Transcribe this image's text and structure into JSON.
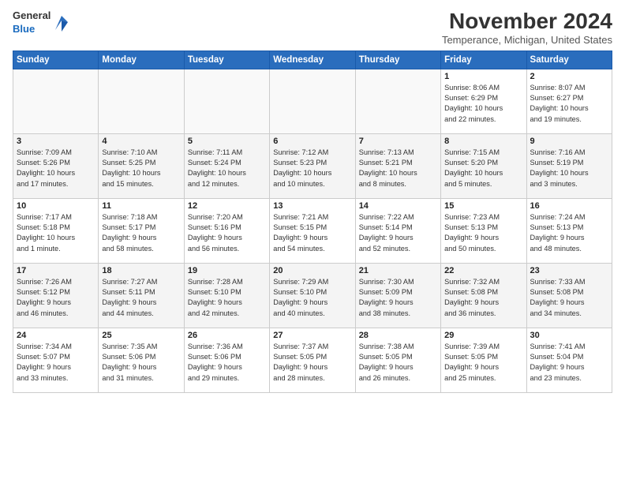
{
  "logo": {
    "line1": "General",
    "line2": "Blue"
  },
  "title": "November 2024",
  "location": "Temperance, Michigan, United States",
  "weekdays": [
    "Sunday",
    "Monday",
    "Tuesday",
    "Wednesday",
    "Thursday",
    "Friday",
    "Saturday"
  ],
  "weeks": [
    [
      {
        "day": "",
        "info": ""
      },
      {
        "day": "",
        "info": ""
      },
      {
        "day": "",
        "info": ""
      },
      {
        "day": "",
        "info": ""
      },
      {
        "day": "",
        "info": ""
      },
      {
        "day": "1",
        "info": "Sunrise: 8:06 AM\nSunset: 6:29 PM\nDaylight: 10 hours\nand 22 minutes."
      },
      {
        "day": "2",
        "info": "Sunrise: 8:07 AM\nSunset: 6:27 PM\nDaylight: 10 hours\nand 19 minutes."
      }
    ],
    [
      {
        "day": "3",
        "info": "Sunrise: 7:09 AM\nSunset: 5:26 PM\nDaylight: 10 hours\nand 17 minutes."
      },
      {
        "day": "4",
        "info": "Sunrise: 7:10 AM\nSunset: 5:25 PM\nDaylight: 10 hours\nand 15 minutes."
      },
      {
        "day": "5",
        "info": "Sunrise: 7:11 AM\nSunset: 5:24 PM\nDaylight: 10 hours\nand 12 minutes."
      },
      {
        "day": "6",
        "info": "Sunrise: 7:12 AM\nSunset: 5:23 PM\nDaylight: 10 hours\nand 10 minutes."
      },
      {
        "day": "7",
        "info": "Sunrise: 7:13 AM\nSunset: 5:21 PM\nDaylight: 10 hours\nand 8 minutes."
      },
      {
        "day": "8",
        "info": "Sunrise: 7:15 AM\nSunset: 5:20 PM\nDaylight: 10 hours\nand 5 minutes."
      },
      {
        "day": "9",
        "info": "Sunrise: 7:16 AM\nSunset: 5:19 PM\nDaylight: 10 hours\nand 3 minutes."
      }
    ],
    [
      {
        "day": "10",
        "info": "Sunrise: 7:17 AM\nSunset: 5:18 PM\nDaylight: 10 hours\nand 1 minute."
      },
      {
        "day": "11",
        "info": "Sunrise: 7:18 AM\nSunset: 5:17 PM\nDaylight: 9 hours\nand 58 minutes."
      },
      {
        "day": "12",
        "info": "Sunrise: 7:20 AM\nSunset: 5:16 PM\nDaylight: 9 hours\nand 56 minutes."
      },
      {
        "day": "13",
        "info": "Sunrise: 7:21 AM\nSunset: 5:15 PM\nDaylight: 9 hours\nand 54 minutes."
      },
      {
        "day": "14",
        "info": "Sunrise: 7:22 AM\nSunset: 5:14 PM\nDaylight: 9 hours\nand 52 minutes."
      },
      {
        "day": "15",
        "info": "Sunrise: 7:23 AM\nSunset: 5:13 PM\nDaylight: 9 hours\nand 50 minutes."
      },
      {
        "day": "16",
        "info": "Sunrise: 7:24 AM\nSunset: 5:13 PM\nDaylight: 9 hours\nand 48 minutes."
      }
    ],
    [
      {
        "day": "17",
        "info": "Sunrise: 7:26 AM\nSunset: 5:12 PM\nDaylight: 9 hours\nand 46 minutes."
      },
      {
        "day": "18",
        "info": "Sunrise: 7:27 AM\nSunset: 5:11 PM\nDaylight: 9 hours\nand 44 minutes."
      },
      {
        "day": "19",
        "info": "Sunrise: 7:28 AM\nSunset: 5:10 PM\nDaylight: 9 hours\nand 42 minutes."
      },
      {
        "day": "20",
        "info": "Sunrise: 7:29 AM\nSunset: 5:10 PM\nDaylight: 9 hours\nand 40 minutes."
      },
      {
        "day": "21",
        "info": "Sunrise: 7:30 AM\nSunset: 5:09 PM\nDaylight: 9 hours\nand 38 minutes."
      },
      {
        "day": "22",
        "info": "Sunrise: 7:32 AM\nSunset: 5:08 PM\nDaylight: 9 hours\nand 36 minutes."
      },
      {
        "day": "23",
        "info": "Sunrise: 7:33 AM\nSunset: 5:08 PM\nDaylight: 9 hours\nand 34 minutes."
      }
    ],
    [
      {
        "day": "24",
        "info": "Sunrise: 7:34 AM\nSunset: 5:07 PM\nDaylight: 9 hours\nand 33 minutes."
      },
      {
        "day": "25",
        "info": "Sunrise: 7:35 AM\nSunset: 5:06 PM\nDaylight: 9 hours\nand 31 minutes."
      },
      {
        "day": "26",
        "info": "Sunrise: 7:36 AM\nSunset: 5:06 PM\nDaylight: 9 hours\nand 29 minutes."
      },
      {
        "day": "27",
        "info": "Sunrise: 7:37 AM\nSunset: 5:05 PM\nDaylight: 9 hours\nand 28 minutes."
      },
      {
        "day": "28",
        "info": "Sunrise: 7:38 AM\nSunset: 5:05 PM\nDaylight: 9 hours\nand 26 minutes."
      },
      {
        "day": "29",
        "info": "Sunrise: 7:39 AM\nSunset: 5:05 PM\nDaylight: 9 hours\nand 25 minutes."
      },
      {
        "day": "30",
        "info": "Sunrise: 7:41 AM\nSunset: 5:04 PM\nDaylight: 9 hours\nand 23 minutes."
      }
    ]
  ]
}
